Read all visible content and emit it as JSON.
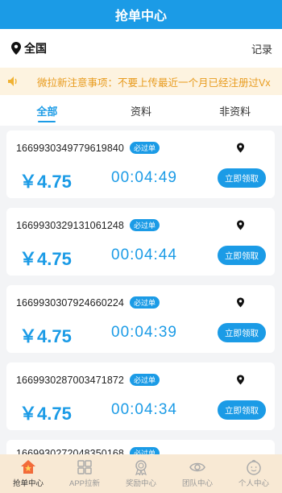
{
  "header": {
    "title": "抢单中心"
  },
  "location": {
    "city": "全国",
    "record_label": "记录"
  },
  "notice": {
    "text": "微拉新注意事项：不要上传最近一个月已经注册过Vx"
  },
  "tabs": [
    {
      "label": "全部",
      "active": true
    },
    {
      "label": "资料",
      "active": false
    },
    {
      "label": "非资料",
      "active": false
    }
  ],
  "orders": [
    {
      "id": "1669930349779619840",
      "tag": "必过单",
      "price": "￥4.75",
      "timer": "00:04:49",
      "action": "立即领取"
    },
    {
      "id": "1669930329131061248",
      "tag": "必过单",
      "price": "￥4.75",
      "timer": "00:04:44",
      "action": "立即领取"
    },
    {
      "id": "1669930307924660224",
      "tag": "必过单",
      "price": "￥4.75",
      "timer": "00:04:39",
      "action": "立即领取"
    },
    {
      "id": "1669930287003471872",
      "tag": "必过单",
      "price": "￥4.75",
      "timer": "00:04:34",
      "action": "立即领取"
    },
    {
      "id": "1669930272048350168",
      "tag": "必过单",
      "price": "",
      "timer": "",
      "action": ""
    }
  ],
  "nav": [
    {
      "label": "抢单中心",
      "icon": "house-star-icon",
      "active": true
    },
    {
      "label": "APP拉新",
      "icon": "grid-icon",
      "active": false
    },
    {
      "label": "奖励中心",
      "icon": "medal-icon",
      "active": false
    },
    {
      "label": "团队中心",
      "icon": "eye-icon",
      "active": false
    },
    {
      "label": "个人中心",
      "icon": "face-icon",
      "active": false
    }
  ],
  "colors": {
    "primary": "#1b9be6",
    "notice_bg": "#fdf3e0",
    "notice_text": "#e89b1e",
    "nav_bg": "#f8e9d4"
  }
}
